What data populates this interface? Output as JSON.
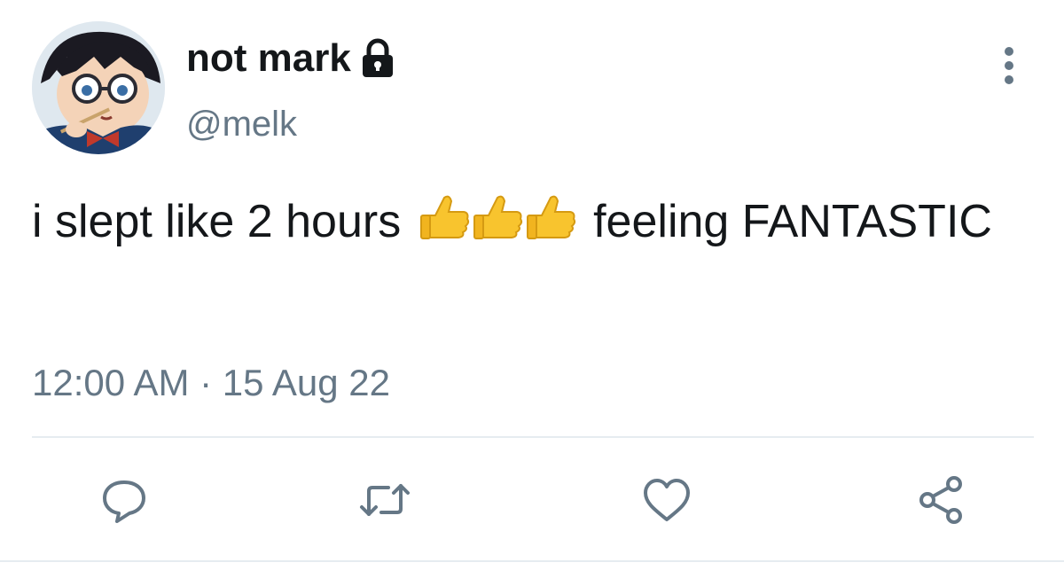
{
  "tweet": {
    "display_name": "not mark",
    "handle": "@melk",
    "text_part1": "i slept like 2 hours ",
    "emojis": [
      "thumbs-up",
      "thumbs-up",
      "thumbs-up"
    ],
    "text_part2": " feeling FANTASTIC",
    "timestamp": "12:00 AM · 15 Aug 22",
    "protected": true
  },
  "actions": [
    {
      "icon": "reply-icon"
    },
    {
      "icon": "retweet-icon"
    },
    {
      "icon": "like-icon"
    },
    {
      "icon": "share-icon"
    }
  ],
  "colors": {
    "text": "#14171a",
    "secondary": "#657786",
    "divider": "#e6ecf0",
    "emoji": "#f8c42e"
  }
}
